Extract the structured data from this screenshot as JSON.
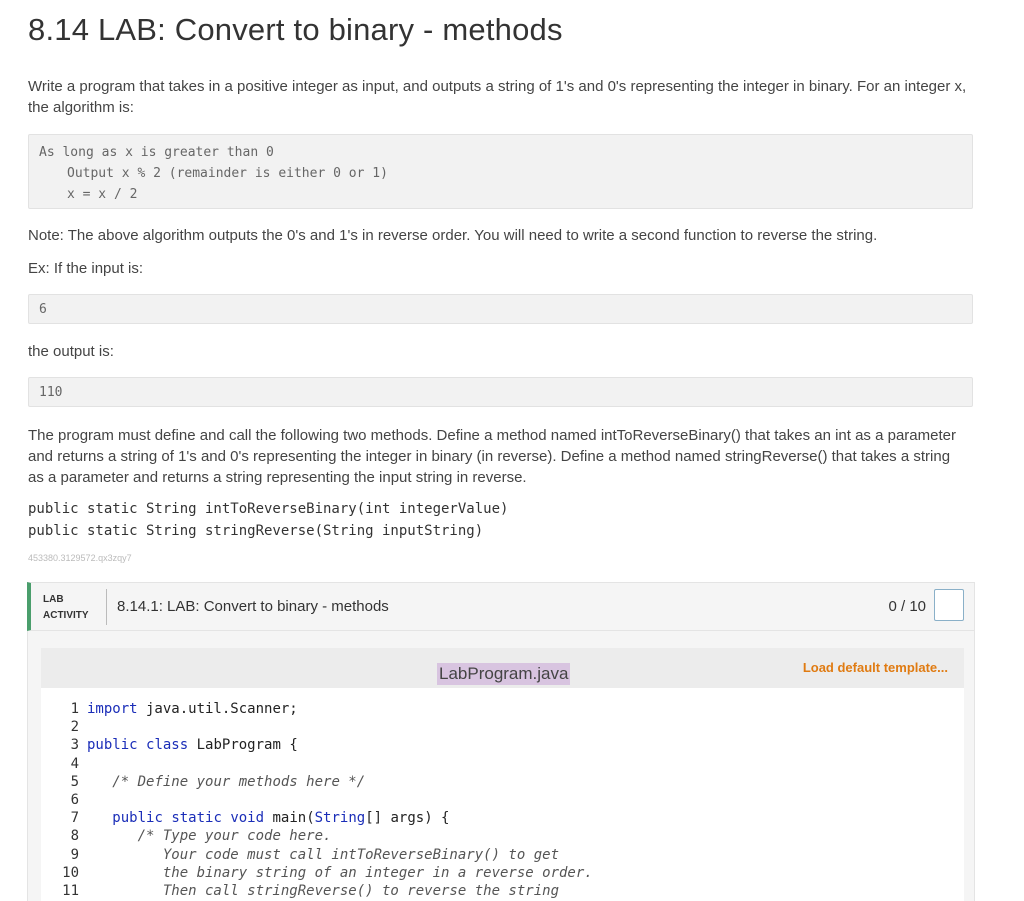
{
  "page_title": "8.14 LAB: Convert to binary - methods",
  "intro": "Write a program that takes in a positive integer as input, and outputs a string of 1's and 0's representing the integer in binary. For an integer x, the algorithm is:",
  "algorithm": {
    "line1": "As long as x is greater than 0",
    "line2": "Output x % 2 (remainder is either 0 or 1)",
    "line3": "x = x / 2"
  },
  "note": "Note: The above algorithm outputs the 0's and 1's in reverse order. You will need to write a second function to reverse the string.",
  "example_label": "Ex: If the input is:",
  "example_input": "6",
  "output_label": "the output is:",
  "example_output": "110",
  "methods_paragraph": "The program must define and call the following two methods. Define a method named intToReverseBinary() that takes an int as a parameter and returns a string of 1's and 0's representing the integer in binary (in reverse). Define a method named stringReverse() that takes a string as a parameter and returns a string representing the input string in reverse.",
  "signature1": "public static String intToReverseBinary(int integerValue)",
  "signature2": "public static String stringReverse(String inputString)",
  "tracking_id": "453380.3129572.qx3zqy7",
  "lab": {
    "tag_line1": "LAB",
    "tag_line2": "ACTIVITY",
    "title": "8.14.1: LAB: Convert to binary - methods",
    "score": "0 / 10",
    "accent_color": "#4a9e6c"
  },
  "editor": {
    "filename": "LabProgram.java",
    "load_template": "Load default template...",
    "lines": [
      {
        "n": "1",
        "parts": [
          [
            "kw",
            "import"
          ],
          [
            "t",
            " java.util.Scanner;"
          ]
        ]
      },
      {
        "n": "2",
        "parts": []
      },
      {
        "n": "3",
        "parts": [
          [
            "kw",
            "public"
          ],
          [
            "t",
            " "
          ],
          [
            "kw",
            "class"
          ],
          [
            "t",
            " LabProgram {"
          ]
        ]
      },
      {
        "n": "4",
        "parts": []
      },
      {
        "n": "5",
        "parts": [
          [
            "t",
            "   "
          ],
          [
            "cm",
            "/* Define your methods here */"
          ]
        ]
      },
      {
        "n": "6",
        "parts": []
      },
      {
        "n": "7",
        "parts": [
          [
            "t",
            "   "
          ],
          [
            "kw",
            "public"
          ],
          [
            "t",
            " "
          ],
          [
            "kw",
            "static"
          ],
          [
            "t",
            " "
          ],
          [
            "kw",
            "void"
          ],
          [
            "t",
            " main("
          ],
          [
            "kw",
            "String"
          ],
          [
            "t",
            "[] args) {"
          ]
        ]
      },
      {
        "n": "8",
        "parts": [
          [
            "t",
            "      "
          ],
          [
            "cm",
            "/* Type your code here."
          ]
        ]
      },
      {
        "n": "9",
        "parts": [
          [
            "cm",
            "         Your code must call intToReverseBinary() to get"
          ]
        ]
      },
      {
        "n": "10",
        "parts": [
          [
            "cm",
            "         the binary string of an integer in a reverse order."
          ]
        ]
      },
      {
        "n": "11",
        "parts": [
          [
            "cm",
            "         Then call stringReverse() to reverse the string"
          ]
        ]
      }
    ]
  }
}
